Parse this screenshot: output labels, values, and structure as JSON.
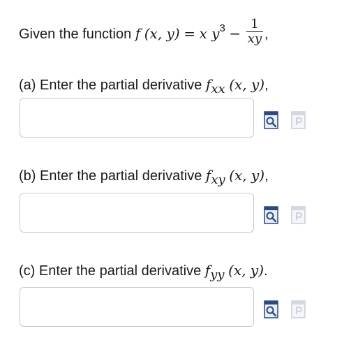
{
  "intro": {
    "prefix": "Given the function",
    "func": "f",
    "args": "(x, y)",
    "equals": "=",
    "term1": "x y",
    "exp": "3",
    "minus": "−",
    "numerator": "1",
    "denominator": "xy",
    "suffix": ","
  },
  "parts": [
    {
      "label": "(a) Enter the partial derivative",
      "func": "f",
      "sub": "xx",
      "args": "(x, y)",
      "end": ",",
      "input_value": "",
      "icons": [
        "preview-icon",
        "paste-icon"
      ]
    },
    {
      "label": "(b) Enter the partial derivative",
      "func": "f",
      "sub": "xy",
      "args": "(x, y)",
      "end": ",",
      "input_value": "",
      "icons": [
        "preview-icon",
        "paste-icon"
      ]
    },
    {
      "label": "(c) Enter the partial derivative",
      "func": "f",
      "sub": "yy",
      "args": "(x, y)",
      "end": ".",
      "input_value": "",
      "icons": [
        "preview-icon",
        "paste-icon"
      ]
    }
  ],
  "colors": {
    "preview_icon": "#2c4a7e",
    "paste_icon_disabled": "#c8ced8",
    "input_border": "#c9c9c9"
  }
}
